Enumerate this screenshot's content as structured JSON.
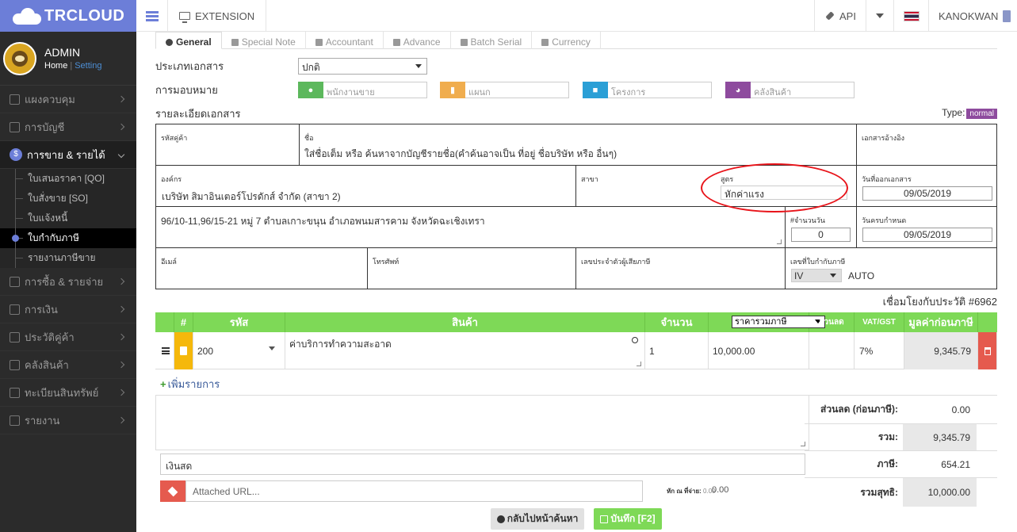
{
  "brand": {
    "name": "TRCLOUD"
  },
  "topbar": {
    "extension_label": "EXTENSION",
    "api_label": "API",
    "user_name": "KANOKWAN"
  },
  "profile": {
    "name": "ADMIN",
    "home_link": "Home",
    "separator": "|",
    "setting_link": "Setting"
  },
  "sidebar": {
    "items": [
      {
        "label": "แผงควบคุม"
      },
      {
        "label": "การบัญชี"
      },
      {
        "label": "การขาย & รายได้"
      },
      {
        "label": "การซื้อ & รายจ่าย"
      },
      {
        "label": "การเงิน"
      },
      {
        "label": "ประวัติคู่ค้า"
      },
      {
        "label": "คลังสินค้า"
      },
      {
        "label": "ทะเบียนสินทรัพย์"
      },
      {
        "label": "รายงาน"
      }
    ],
    "active_icon": "$",
    "subitems": [
      {
        "label": "ใบเสนอราคา [QO]"
      },
      {
        "label": "ใบสั่งขาย [SO]"
      },
      {
        "label": "ใบแจ้งหนี้"
      },
      {
        "label": "ใบกำกับภาษี"
      },
      {
        "label": "รายงานภาษีขาย"
      }
    ]
  },
  "tabs": [
    {
      "label": "General"
    },
    {
      "label": "Special Note"
    },
    {
      "label": "Accountant"
    },
    {
      "label": "Advance"
    },
    {
      "label": "Batch Serial"
    },
    {
      "label": "Currency"
    }
  ],
  "form": {
    "doc_type_label": "ประเภทเอกสาร",
    "doc_type_value": "ปกติ",
    "assign_label": "การมอบหมาย",
    "assign_fields": [
      {
        "placeholder": "พนักงานขาย",
        "color": "#5cb85c"
      },
      {
        "placeholder": "แผนก",
        "color": "#f0ad4e"
      },
      {
        "placeholder": "โครงการ",
        "color": "#2a9fd6"
      },
      {
        "placeholder": "คลังสินค้า",
        "color": "#8e4b9e"
      }
    ],
    "detail_label": "รายละเอียดเอกสาร",
    "type_label": "Type:",
    "type_badge": "normal"
  },
  "customer": {
    "code_label": "รหัสคู่ค้า",
    "name_label": "ชื่อ",
    "name_hint": "ใส่ชื่อเต็ม หรือ ค้นหาจากบัญชีรายชื่อ(คำค้นอาจเป็น ที่อยู่ ชื่อบริษัท หรือ อื่นๆ)",
    "ref_doc_label": "เอกสารอ้างอิง",
    "org_label": "องค์กร",
    "org_value": "เบริษัท สิมาอินเตอร์โปรดักส์ จำกัด (สาขา 2)",
    "branch_label": "สาขา",
    "formula_label": "สูตร",
    "formula_value": "หักค่าแรง",
    "issue_date_label": "วันที่ออกเอกสาร",
    "issue_date": "09/05/2019",
    "address": "96/10-11,96/15-21 หมู่ 7 ตำบลเกาะขนุน อำเภอพนมสารคาม จังหวัดฉะเชิงเทรา",
    "days_label": "#จำนวนวัน",
    "days_value": "0",
    "due_date_label": "วันครบกำหนด",
    "due_date": "09/05/2019",
    "email_label": "อีเมล์",
    "phone_label": "โทรศัพท์",
    "taxid_label": "เลขประจำตัวผู้เสียภาษี",
    "taxinv_label": "เลขที่ใบกำกับภาษี",
    "taxinv_prefix": "IV",
    "taxinv_auto": "AUTO"
  },
  "history_link": "เชื่อมโยงกับประวัติ #6962",
  "items": {
    "headers": {
      "num": "#",
      "code": "รหัส",
      "product": "สินค้า",
      "qty": "จำนวน",
      "price_mode": "ราคารวมภาษี",
      "discount": "ส่วนลด",
      "vat": "VAT/GST",
      "pretax": "มูลค่าก่อนภาษี"
    },
    "rows": [
      {
        "code": "200",
        "description": "ค่าบริการทำความสะอาด",
        "qty": "1",
        "price": "10,000.00",
        "vat": "7%",
        "pretax": "9,345.79"
      }
    ],
    "add_label": "เพิ่มรายการ"
  },
  "summary": {
    "discount_label": "ส่วนลด (ก่อนภาษี):",
    "discount_value": "0.00",
    "total_label": "รวม:",
    "total_value": "9,345.79",
    "tax_label": "ภาษี:",
    "tax_value": "654.21",
    "net_label": "รวมสุทธิ:",
    "net_value": "10,000.00"
  },
  "payment": {
    "method": "เงินสด",
    "url_placeholder": "Attached URL...",
    "wht_label": "หัก ณ ที่จ่าย:",
    "wht_small": "0.00",
    "wht_value": "0.00"
  },
  "buttons": {
    "back": "กลับไปหน้าค้นหา",
    "save": "บันทึก [F2]"
  }
}
